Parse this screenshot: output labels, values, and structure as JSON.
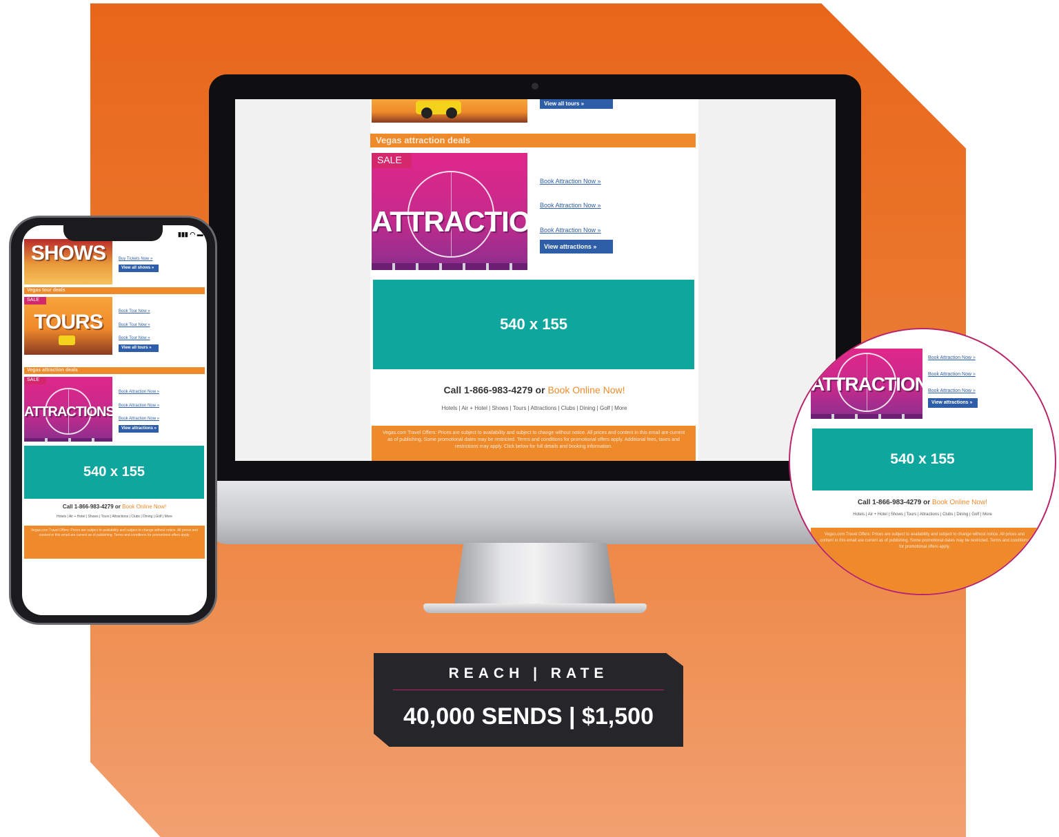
{
  "colors": {
    "brand_orange": "#ea6a1c",
    "email_orange": "#ef8a2b",
    "teal": "#0fa79d",
    "link_blue": "#2e5ea8",
    "accent_magenta": "#b8256a",
    "label_dark": "#26262a"
  },
  "desktop": {
    "view_tours_button": "View all tours »",
    "section_title": "Vegas attraction deals",
    "sale_badge": "SALE",
    "banner_word": "ATTRACTIONS",
    "links": [
      "Book Attraction Now »",
      "Book Attraction Now »",
      "Book Attraction Now »"
    ],
    "view_button": "View attractions »",
    "ad_size": "540 x 155",
    "call_text": "Call 1-866-983-4279 or",
    "book_text": "Book Online Now!",
    "nav": "Hotels | Air + Hotel | Shows | Tours | Attractions | Clubs | Dining | Golf | More",
    "footer_text": "Vegas.com Travel Offers: Prices are subject to availability and subject to change without notice. All prices and content in this email are current as of publishing. Some promotional dates may be restricted. Terms and conditions for promotional offers apply. Additional fees, taxes and restrictions may apply. Click below for full details and booking information."
  },
  "phone": {
    "status_icons": "signal-wifi-battery",
    "shows_word": "SHOWS",
    "shows_link": "Buy Tickets Now »",
    "shows_button": "View all shows »",
    "tours_section": "Vegas tour deals",
    "sale_badge": "SALE",
    "tours_word": "TOURS",
    "tours_links": [
      "Book Tour Now »",
      "Book Tour Now »",
      "Book Tour Now »"
    ],
    "tours_button": "View all tours »",
    "attr_section": "Vegas attraction deals",
    "attr_word": "ATTRACTIONS",
    "attr_links": [
      "Book Attraction Now »",
      "Book Attraction Now »",
      "Book Attraction Now »"
    ],
    "attr_button": "View attractions »",
    "ad_size": "540 x 155",
    "call_text": "Call 1-866-983-4279 or",
    "book_text": "Book Online Now!",
    "nav": "Hotels | Air + Hotel | Shows | Tours | Attractions | Clubs | Dining | Golf | More",
    "footer_text": "Vegas.com Travel Offers: Prices are subject to availability and subject to change without notice. All prices and content in this email are current as of publishing. Terms and conditions for promotional offers apply."
  },
  "zoom": {
    "banner_word": "ATTRACTIONS",
    "links": [
      "Book Attraction Now »",
      "Book Attraction Now »",
      "Book Attraction Now »"
    ],
    "view_button": "View attractions »",
    "ad_size": "540 x 155",
    "call_text": "Call 1-866-983-4279 or",
    "book_text": "Book Online Now!",
    "nav": "Hotels | Air + Hotel | Shows | Tours | Attractions | Clubs | Dining | Golf | More",
    "footer_text": "Vegas.com Travel Offers: Prices are subject to availability and subject to change without notice. All prices and content in this email are current as of publishing. Some promotional dates may be restricted. Terms and conditions for promotional offers apply."
  },
  "label": {
    "title": "REACH | RATE",
    "value": "40,000 SENDS | $1,500"
  }
}
